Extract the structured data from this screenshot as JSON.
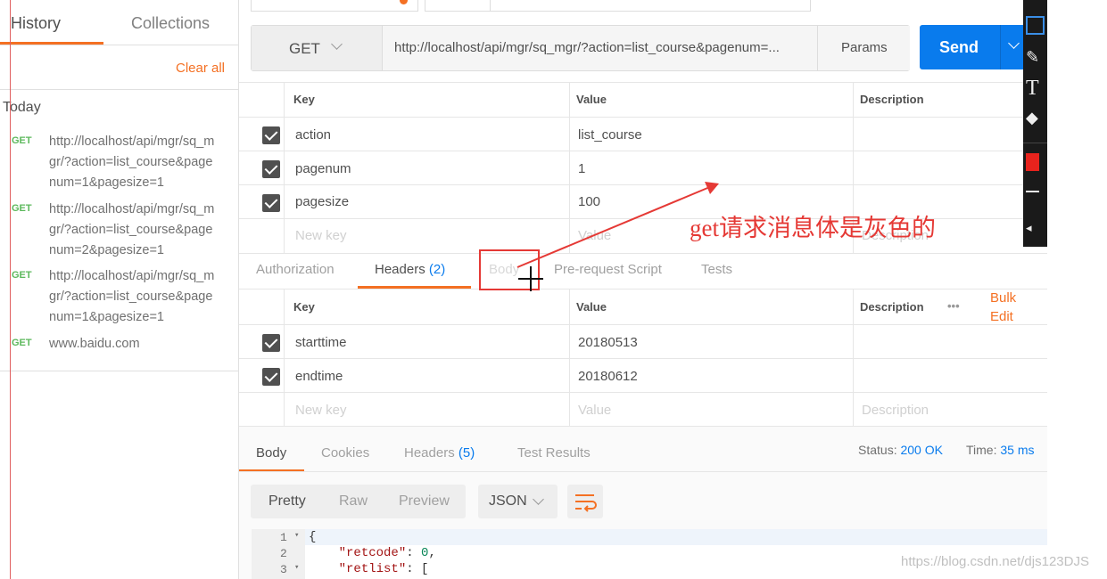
{
  "sidebar": {
    "tabs": [
      "History",
      "Collections"
    ],
    "clear_all": "Clear all",
    "group_label": "Today",
    "items": [
      {
        "method": "GET",
        "url": "http://localhost/api/mgr/sq_mgr/?action=list_course&pagenum=1&pagesize=1"
      },
      {
        "method": "GET",
        "url": "http://localhost/api/mgr/sq_mgr/?action=list_course&pagenum=2&pagesize=1"
      },
      {
        "method": "GET",
        "url": "http://localhost/api/mgr/sq_mgr/?action=list_course&pagenum=1&pagesize=1"
      },
      {
        "method": "GET",
        "url": "www.baidu.com"
      }
    ]
  },
  "request": {
    "method": "GET",
    "url": "http://localhost/api/mgr/sq_mgr/?action=list_course&pagenum=...",
    "params_label": "Params",
    "send_label": "Send"
  },
  "params_table": {
    "headers": [
      "Key",
      "Value",
      "Description"
    ],
    "rows": [
      {
        "key": "action",
        "value": "list_course"
      },
      {
        "key": "pagenum",
        "value": "1"
      },
      {
        "key": "pagesize",
        "value": "100"
      }
    ],
    "placeholders": {
      "key": "New key",
      "value": "Value",
      "description": "Description"
    }
  },
  "request_tabs": {
    "authorization": "Authorization",
    "headers": "Headers",
    "headers_count": "(2)",
    "body": "Body",
    "prerequest": "Pre-request Script",
    "tests": "Tests"
  },
  "headers_table": {
    "headers": [
      "Key",
      "Value",
      "Description"
    ],
    "more": "•••",
    "bulk_edit": [
      "Bulk",
      "Edit"
    ],
    "rows": [
      {
        "key": "starttime",
        "value": "20180513"
      },
      {
        "key": "endtime",
        "value": "20180612"
      }
    ],
    "placeholders": {
      "key": "New key",
      "value": "Value",
      "description": "Description"
    }
  },
  "response_tabs": {
    "body": "Body",
    "cookies": "Cookies",
    "headers": "Headers",
    "headers_count": "(5)",
    "test_results": "Test Results"
  },
  "response_status": {
    "status_label": "Status:",
    "status_value": "200 OK",
    "time_label": "Time:",
    "time_value": "35 ms"
  },
  "view_modes": {
    "pretty": "Pretty",
    "raw": "Raw",
    "preview": "Preview",
    "format": "JSON"
  },
  "code": {
    "line_numbers": [
      "1",
      "2",
      "3"
    ],
    "line1": "{",
    "line2_key": "\"retcode\"",
    "line2_value": "0",
    "line3_key": "\"retlist\"",
    "line3_rest": ": ["
  },
  "annotation": {
    "text": "get请求消息体是灰色的",
    "color": "#e53935"
  },
  "watermark": "https://blog.csdn.net/djs123DJS",
  "colors": {
    "accent": "#f47023",
    "send": "#097bed",
    "get": "#5cb85c"
  }
}
